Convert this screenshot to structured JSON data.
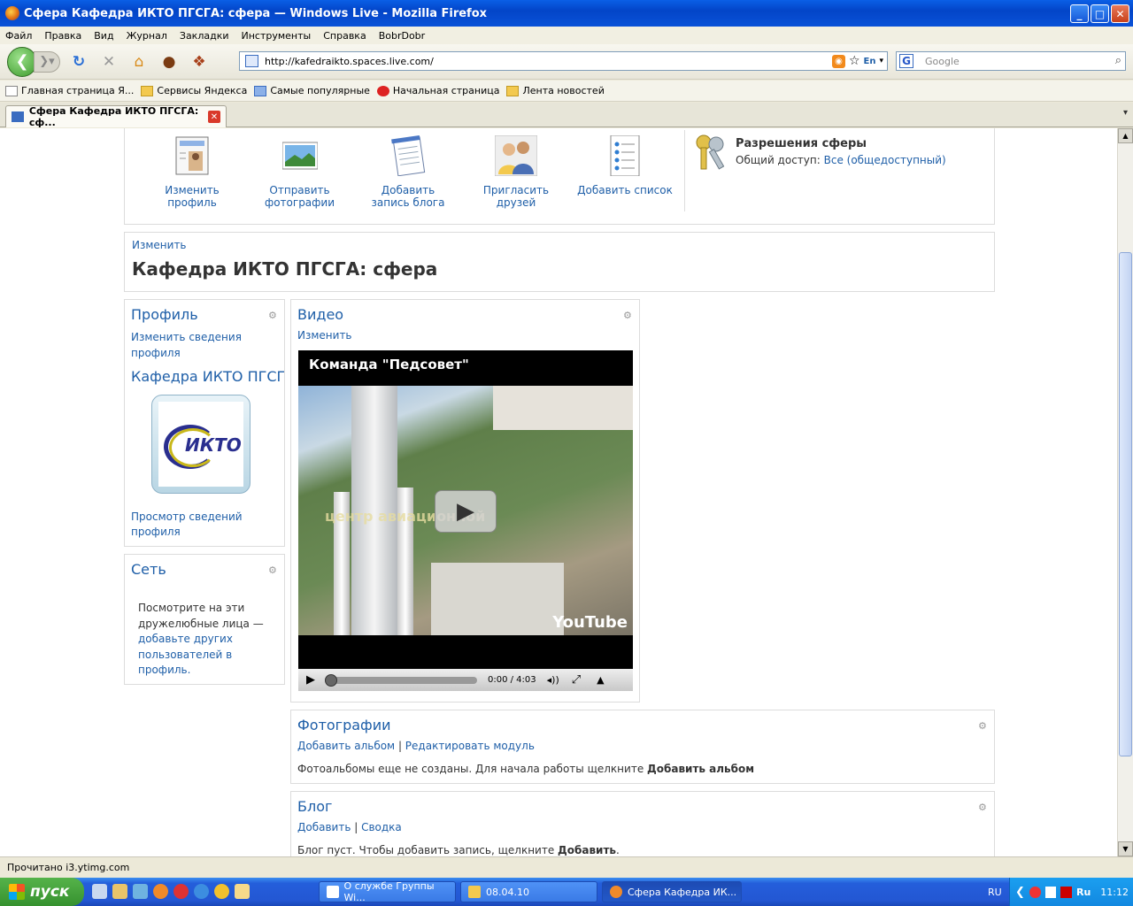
{
  "window": {
    "title": "Сфера Кафедра ИКТО ПГСГА: сфера — Windows Live - Mozilla Firefox"
  },
  "menu": [
    "Файл",
    "Правка",
    "Вид",
    "Журнал",
    "Закладки",
    "Инструменты",
    "Справка",
    "BobrDobr"
  ],
  "nav": {
    "url": "http://kafedraikto.spaces.live.com/",
    "search_placeholder": "Google",
    "lang_badge": "En"
  },
  "bookmarks": [
    "Главная страница Я...",
    "Сервисы Яндекса",
    "Самые популярные",
    "Начальная страница",
    "Лента новостей"
  ],
  "tab": {
    "label": "Сфера Кафедра ИКТО ПГСГА: сф..."
  },
  "page": {
    "actions": [
      "Изменить профиль",
      "Отправить фотографии",
      "Добавить запись блога",
      "Пригласить друзей",
      "Добавить список"
    ],
    "permissions": {
      "title": "Разрешения сферы",
      "label": "Общий доступ:",
      "value": "Все (общедоступный)"
    },
    "header": {
      "edit": "Изменить",
      "title": "Кафедра ИКТО ПГСГА: сфера"
    },
    "profile": {
      "title": "Профиль",
      "edit_link": "Изменить сведения профиля",
      "name": "Кафедра ИКТО ПГСГА",
      "logo_text": "ИКТО",
      "view_link": "Просмотр сведений профиля"
    },
    "network": {
      "title": "Сеть",
      "text": "Посмотрите на эти дружелюбные лица —",
      "link": "добавьте других пользователей в профиль."
    },
    "video": {
      "title": "Видео",
      "edit": "Изменить",
      "video_title": "Команда \"Педсовет\"",
      "overlay": "центр авиационной",
      "time": "0:00 / 4:03",
      "brand": "YouTube"
    },
    "photos": {
      "title": "Фотографии",
      "add": "Добавить альбом",
      "edit": "Редактировать модуль",
      "text": "Фотоальбомы еще не созданы. Для начала работы щелкните",
      "bold": "Добавить альбом"
    },
    "blog": {
      "title": "Блог",
      "add": "Добавить",
      "summary": "Сводка",
      "text": "Блог пуст. Чтобы добавить запись, щелкните",
      "bold": "Добавить"
    }
  },
  "status": "Прочитано i3.ytimg.com",
  "taskbar": {
    "start": "пуск",
    "tasks": [
      "О службе Группы Wi...",
      "08.04.10",
      "Сфера Кафедра ИК..."
    ],
    "lang": "RU",
    "tray_lang": "Ru",
    "clock": "11:12"
  }
}
